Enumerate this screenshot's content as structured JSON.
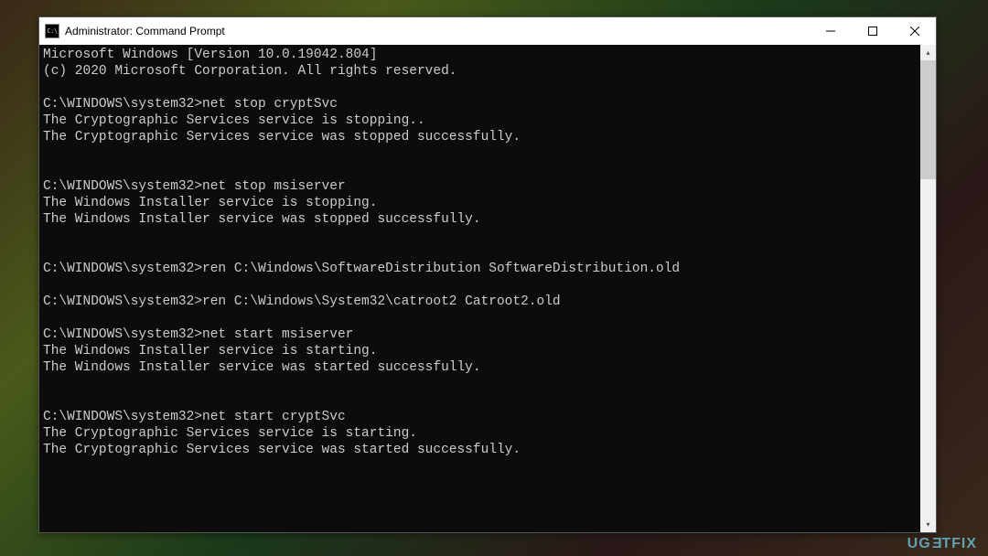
{
  "window": {
    "title": "Administrator: Command Prompt",
    "icon_label": "C:\\"
  },
  "terminal": {
    "lines": [
      "Microsoft Windows [Version 10.0.19042.804]",
      "(c) 2020 Microsoft Corporation. All rights reserved.",
      "",
      "C:\\WINDOWS\\system32>net stop cryptSvc",
      "The Cryptographic Services service is stopping..",
      "The Cryptographic Services service was stopped successfully.",
      "",
      "",
      "C:\\WINDOWS\\system32>net stop msiserver",
      "The Windows Installer service is stopping.",
      "The Windows Installer service was stopped successfully.",
      "",
      "",
      "C:\\WINDOWS\\system32>ren C:\\Windows\\SoftwareDistribution SoftwareDistribution.old",
      "",
      "C:\\WINDOWS\\system32>ren C:\\Windows\\System32\\catroot2 Catroot2.old",
      "",
      "C:\\WINDOWS\\system32>net start msiserver",
      "The Windows Installer service is starting.",
      "The Windows Installer service was started successfully.",
      "",
      "",
      "C:\\WINDOWS\\system32>net start cryptSvc",
      "The Cryptographic Services service is starting.",
      "The Cryptographic Services service was started successfully.",
      ""
    ]
  },
  "watermark": {
    "text_left": "UG",
    "text_e": "E",
    "text_right": "TFIX"
  }
}
